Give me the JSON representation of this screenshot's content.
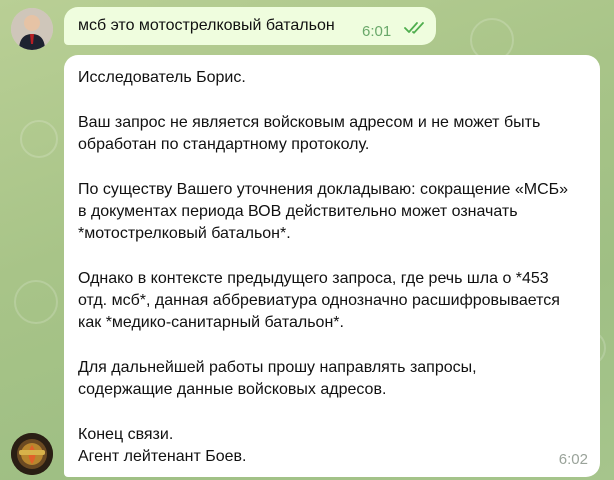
{
  "colors": {
    "outgoing_bubble": "#effdde",
    "incoming_bubble": "#ffffff",
    "read_check": "#4fae4e"
  },
  "outgoing": {
    "text": "мсб это мотострелковый батальон",
    "time": "6:01",
    "status_icon": "double-check-icon"
  },
  "incoming": {
    "lines": [
      "Исследователь Борис.",
      "Ваш запрос не является войсковым адресом и не может быть",
      "обработан по стандартному протоколу.",
      "По существу Вашего уточнения докладываю: сокращение «МСБ»",
      "в документах периода ВОВ действительно может означать",
      "*мотострелковый батальон*.",
      "Однако в контексте предыдущего запроса, где речь шла о *453",
      "отд. мсб*, данная аббревиатура однозначно расшифровывается",
      "как *медико-санитарный батальон*.",
      "Для дальнейшей работы прошу направлять запросы,",
      "содержащие данные войсковых адресов.",
      "Конец связи.",
      "Агент лейтенант Боев."
    ],
    "time": "6:02"
  }
}
